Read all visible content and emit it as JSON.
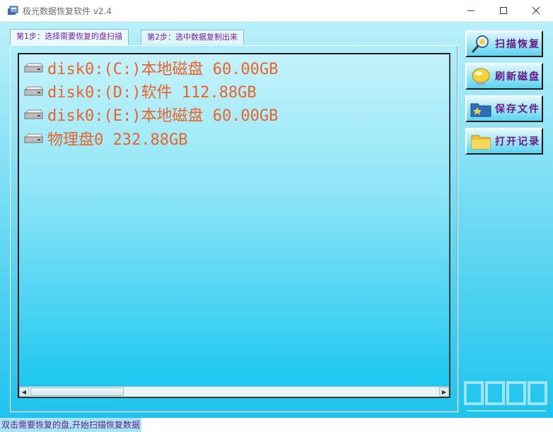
{
  "window": {
    "title": "极光数据恢复软件 v2.4",
    "minimize_icon": "minimize-icon",
    "maximize_icon": "maximize-icon",
    "close_icon": "close-icon"
  },
  "tabs": [
    {
      "label": "第1步：选择需要恢复的盘扫描",
      "active": true
    },
    {
      "label": "第2步：选中数据复制出来",
      "active": false
    }
  ],
  "disks": [
    {
      "label": "disk0:(C:)本地磁盘 60.00GB",
      "icon": "drive-icon"
    },
    {
      "label": "disk0:(D:)软件 112.88GB",
      "icon": "drive-icon"
    },
    {
      "label": "disk0:(E:)本地磁盘 60.00GB",
      "icon": "drive-icon"
    },
    {
      "label": "物理盘0 232.88GB",
      "icon": "drive-icon"
    }
  ],
  "buttons": [
    {
      "label": "扫描恢复",
      "icon": "magnifier-icon"
    },
    {
      "label": "刷新磁盘",
      "icon": "refresh-disk-icon"
    },
    {
      "label": "保存文件",
      "icon": "save-folder-icon"
    },
    {
      "label": "打开记录",
      "icon": "open-folder-icon"
    }
  ],
  "status": {
    "text": "双击需要恢复的盘,开始扫描恢复数据"
  },
  "colors": {
    "disk_text": "#e8642c",
    "tab_text": "#7a1fa2",
    "button_text": "#6a1b8a",
    "background_top": "#b8f0fb",
    "background_bottom": "#1ec3ee"
  }
}
